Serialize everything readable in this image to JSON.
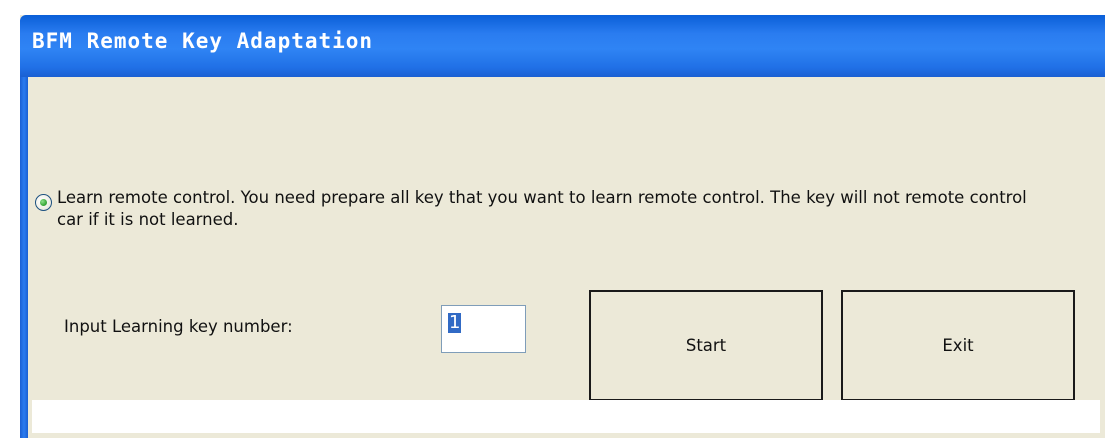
{
  "window": {
    "title": "BFM Remote Key Adaptation"
  },
  "options": {
    "learn_remote": {
      "label": "Learn remote control. You need prepare all key that you want to learn remote control. The key will not remote control car if it is not learned.",
      "selected": true
    }
  },
  "key_number": {
    "label": "Input Learning key number:",
    "value": "1"
  },
  "buttons": {
    "start": "Start",
    "exit": "Exit"
  },
  "status": {
    "text": ""
  },
  "colors": {
    "titlebar": "#2f84f4",
    "window_bg": "#ece9d8",
    "title_text": "#ffffff",
    "radio_dot": "#3ca93a",
    "selection": "#316ac5"
  }
}
